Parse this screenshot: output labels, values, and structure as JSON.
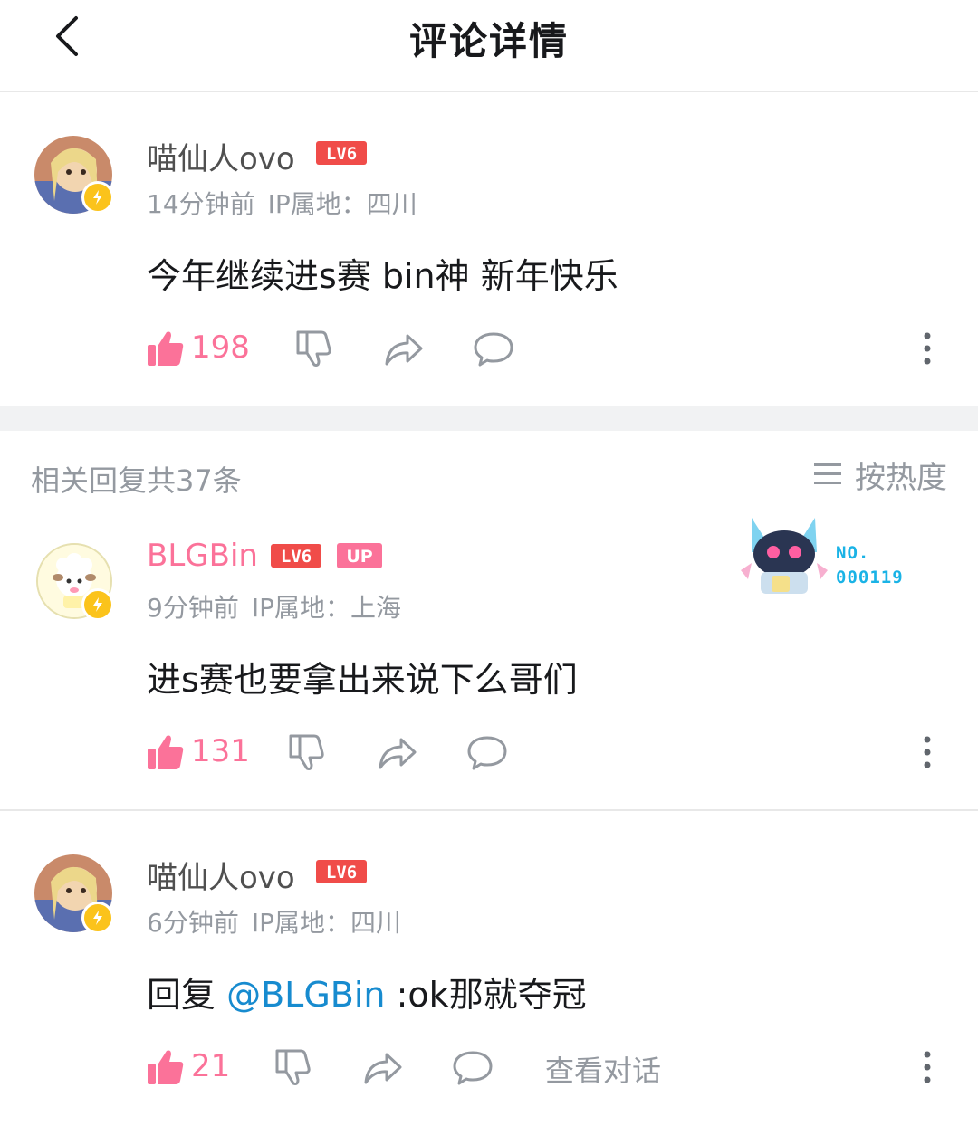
{
  "header": {
    "title": "评论详情"
  },
  "root_comment": {
    "username": "喵仙人ovo",
    "level": "LV6",
    "time": "14分钟前",
    "ip": "IP属地：四川",
    "content": "今年继续进s赛 bin神 新年快乐",
    "likes": "198"
  },
  "replies_header": {
    "count_text": "相关回复共37条",
    "sort_label": "按热度"
  },
  "replies": [
    {
      "username": "BLGBin",
      "level": "LV6",
      "up_badge": "UP",
      "time": "9分钟前",
      "ip": "IP属地：上海",
      "content": "进s赛也要拿出来说下么哥们",
      "likes": "131",
      "decoration": {
        "no_label": "NO.",
        "number": "000119"
      }
    },
    {
      "username": "喵仙人ovo",
      "level": "LV6",
      "time": "6分钟前",
      "ip": "IP属地：四川",
      "reply_prefix": "回复 ",
      "mention": "@BLGBin",
      "content": " :ok那就夺冠",
      "likes": "21",
      "view_conversation": "查看对话"
    }
  ],
  "colors": {
    "accent_pink": "#fb7299",
    "mention_blue": "#178bcf",
    "meta_gray": "#9499a0",
    "badge_yellow": "#fbc31b",
    "level_red": "#f04c49"
  }
}
